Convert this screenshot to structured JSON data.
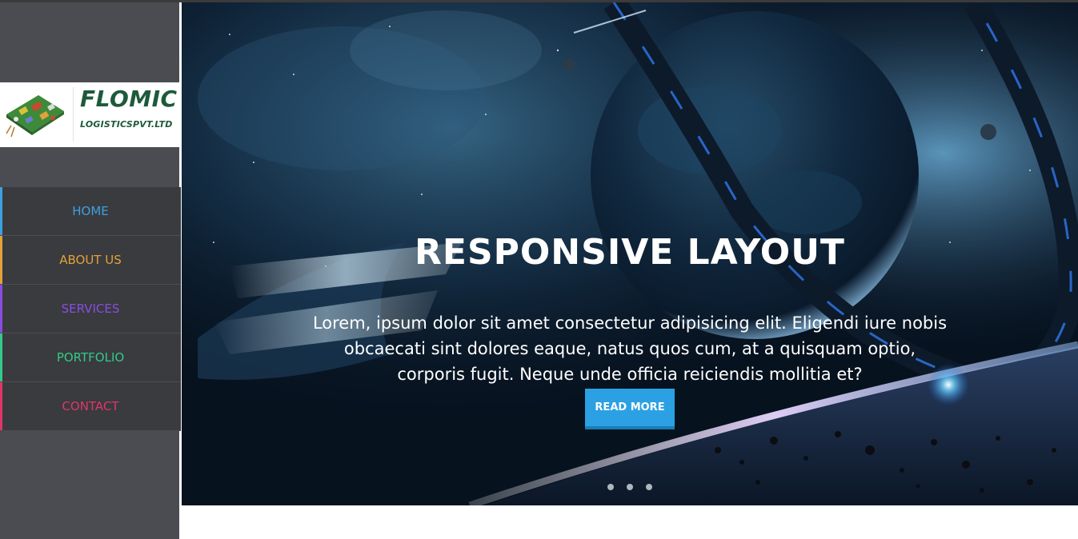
{
  "brand": {
    "name": "FLOMIC",
    "subtitle": "LOGISTICSPVT.LTD",
    "color": "#1e5a3a"
  },
  "nav": {
    "items": [
      {
        "label": "HOME",
        "color": "#3ea0e0"
      },
      {
        "label": "ABOUT US",
        "color": "#e5a03a"
      },
      {
        "label": "SERVICES",
        "color": "#8a4ce0"
      },
      {
        "label": "PORTFOLIO",
        "color": "#34c98a"
      },
      {
        "label": "CONTACT",
        "color": "#e0356a"
      }
    ]
  },
  "hero": {
    "title": "RESPONSIVE LAYOUT",
    "text": "Lorem, ipsum dolor sit amet consectetur adipisicing elit. Eligendi iure nobis obcaecati sint dolores eaque, natus quos cum, at a quisquam optio, corporis fugit. Neque unde officia reiciendis mollitia et?",
    "button_label": "READ MORE",
    "button_color": "#2ba1e3",
    "slide_count": 3,
    "background": "space-scene-image"
  }
}
